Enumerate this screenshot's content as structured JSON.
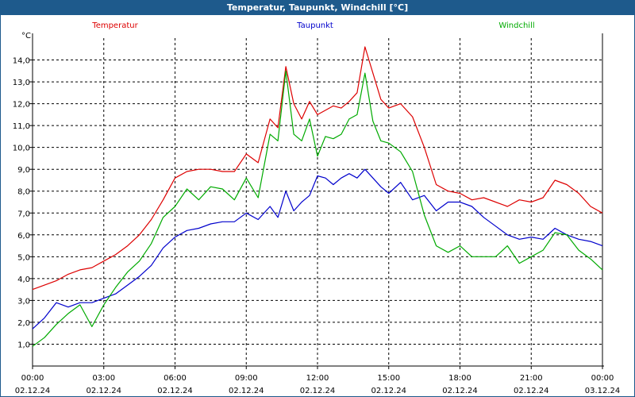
{
  "window": {
    "title": "Temperatur, Taupunkt, Windchill [°C]"
  },
  "chart_data": {
    "type": "line",
    "ylabel": "°C",
    "ylim": [
      0.0,
      15.0
    ],
    "y_ticks": [
      "1,0",
      "2,0",
      "3,0",
      "4,0",
      "5,0",
      "6,0",
      "7,0",
      "8,0",
      "9,0",
      "10,0",
      "11,0",
      "12,0",
      "13,0",
      "14,0"
    ],
    "x_ticks": [
      {
        "time": "00:00",
        "date": "02.12.24"
      },
      {
        "time": "03:00",
        "date": "02.12.24"
      },
      {
        "time": "06:00",
        "date": "02.12.24"
      },
      {
        "time": "09:00",
        "date": "02.12.24"
      },
      {
        "time": "12:00",
        "date": "02.12.24"
      },
      {
        "time": "15:00",
        "date": "02.12.24"
      },
      {
        "time": "18:00",
        "date": "02.12.24"
      },
      {
        "time": "21:00",
        "date": "02.12.24"
      },
      {
        "time": "00:00",
        "date": "03.12.24"
      }
    ],
    "grid": true,
    "legend": "top",
    "series": [
      {
        "name": "Temperatur",
        "color": "#dd0000",
        "x": [
          "00:00",
          "00:30",
          "01:00",
          "01:30",
          "02:00",
          "02:30",
          "03:00",
          "03:30",
          "04:00",
          "04:30",
          "05:00",
          "05:30",
          "06:00",
          "06:30",
          "07:00",
          "07:30",
          "08:00",
          "08:30",
          "09:00",
          "09:30",
          "10:00",
          "10:20",
          "10:40",
          "11:00",
          "11:20",
          "11:40",
          "12:00",
          "12:20",
          "12:40",
          "13:00",
          "13:20",
          "13:40",
          "14:00",
          "14:20",
          "14:40",
          "15:00",
          "15:30",
          "16:00",
          "16:30",
          "17:00",
          "17:30",
          "18:00",
          "18:30",
          "19:00",
          "19:30",
          "20:00",
          "20:30",
          "21:00",
          "21:30",
          "22:00",
          "22:30",
          "23:00",
          "23:30",
          "00:00"
        ],
        "y": [
          3.5,
          3.7,
          3.9,
          4.2,
          4.4,
          4.5,
          4.8,
          5.1,
          5.5,
          6.0,
          6.7,
          7.6,
          8.6,
          8.9,
          9.0,
          9.0,
          8.9,
          8.9,
          9.7,
          9.3,
          11.3,
          10.9,
          13.7,
          12.0,
          11.3,
          12.1,
          11.5,
          11.7,
          11.9,
          11.8,
          12.1,
          12.5,
          14.6,
          13.4,
          12.2,
          11.8,
          12.0,
          11.4,
          10.0,
          8.3,
          8.0,
          7.9,
          7.6,
          7.7,
          7.5,
          7.3,
          7.6,
          7.5,
          7.7,
          8.5,
          8.3,
          7.9,
          7.3,
          7.0
        ]
      },
      {
        "name": "Taupunkt",
        "color": "#0000cc",
        "x": [
          "00:00",
          "00:30",
          "01:00",
          "01:30",
          "02:00",
          "02:30",
          "03:00",
          "03:30",
          "04:00",
          "04:30",
          "05:00",
          "05:30",
          "06:00",
          "06:30",
          "07:00",
          "07:30",
          "08:00",
          "08:30",
          "09:00",
          "09:30",
          "10:00",
          "10:20",
          "10:40",
          "11:00",
          "11:20",
          "11:40",
          "12:00",
          "12:20",
          "12:40",
          "13:00",
          "13:20",
          "13:40",
          "14:00",
          "14:20",
          "14:40",
          "15:00",
          "15:30",
          "16:00",
          "16:30",
          "17:00",
          "17:30",
          "18:00",
          "18:30",
          "19:00",
          "19:30",
          "20:00",
          "20:30",
          "21:00",
          "21:30",
          "22:00",
          "22:30",
          "23:00",
          "23:30",
          "00:00"
        ],
        "y": [
          1.7,
          2.2,
          2.9,
          2.7,
          2.9,
          2.9,
          3.1,
          3.3,
          3.7,
          4.1,
          4.6,
          5.4,
          5.9,
          6.2,
          6.3,
          6.5,
          6.6,
          6.6,
          7.0,
          6.7,
          7.3,
          6.8,
          8.0,
          7.1,
          7.5,
          7.8,
          8.7,
          8.6,
          8.3,
          8.6,
          8.8,
          8.6,
          9.0,
          8.6,
          8.2,
          7.9,
          8.4,
          7.6,
          7.8,
          7.1,
          7.5,
          7.5,
          7.3,
          6.8,
          6.4,
          6.0,
          5.8,
          5.9,
          5.8,
          6.3,
          6.0,
          5.8,
          5.7,
          5.5
        ]
      },
      {
        "name": "Windchill",
        "color": "#00aa00",
        "x": [
          "00:00",
          "00:30",
          "01:00",
          "01:30",
          "02:00",
          "02:30",
          "03:00",
          "03:30",
          "04:00",
          "04:30",
          "05:00",
          "05:30",
          "06:00",
          "06:30",
          "07:00",
          "07:30",
          "08:00",
          "08:30",
          "09:00",
          "09:30",
          "10:00",
          "10:20",
          "10:40",
          "11:00",
          "11:20",
          "11:40",
          "12:00",
          "12:20",
          "12:40",
          "13:00",
          "13:20",
          "13:40",
          "14:00",
          "14:20",
          "14:40",
          "15:00",
          "15:30",
          "16:00",
          "16:30",
          "17:00",
          "17:30",
          "18:00",
          "18:30",
          "19:00",
          "19:30",
          "20:00",
          "20:30",
          "21:00",
          "21:30",
          "22:00",
          "22:30",
          "23:00",
          "23:30",
          "00:00"
        ],
        "y": [
          0.9,
          1.3,
          1.9,
          2.4,
          2.8,
          1.8,
          2.8,
          3.6,
          4.3,
          4.8,
          5.6,
          6.8,
          7.3,
          8.1,
          7.6,
          8.2,
          8.1,
          7.6,
          8.6,
          7.7,
          10.6,
          10.3,
          13.5,
          10.6,
          10.3,
          11.3,
          9.6,
          10.5,
          10.4,
          10.6,
          11.3,
          11.5,
          13.4,
          11.2,
          10.3,
          10.2,
          9.8,
          8.9,
          6.9,
          5.5,
          5.2,
          5.5,
          5.0,
          5.0,
          5.0,
          5.5,
          4.7,
          5.0,
          5.3,
          6.1,
          6.0,
          5.3,
          4.9,
          4.4
        ]
      }
    ]
  }
}
